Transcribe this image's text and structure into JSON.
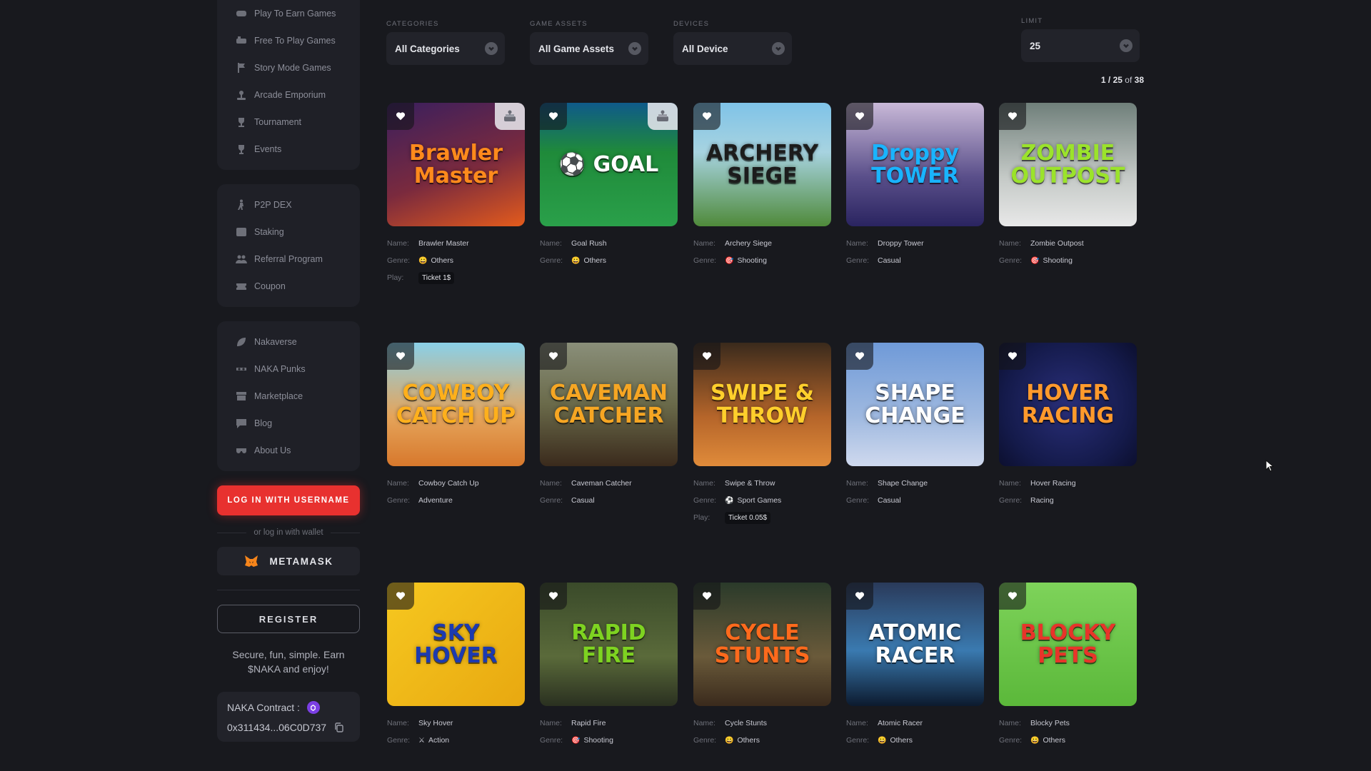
{
  "sidebar": {
    "group1": [
      {
        "label": "Play To Earn Games",
        "icon": "gamepad-icon"
      },
      {
        "label": "Free To Play Games",
        "icon": "controller-icon"
      },
      {
        "label": "Story Mode Games",
        "icon": "flag-icon"
      },
      {
        "label": "Arcade Emporium",
        "icon": "joystick-icon"
      },
      {
        "label": "Tournament",
        "icon": "trophy-icon"
      },
      {
        "label": "Events",
        "icon": "cup-icon"
      }
    ],
    "group2": [
      {
        "label": "P2P DEX",
        "icon": "walk-icon"
      },
      {
        "label": "Staking",
        "icon": "staking-icon"
      },
      {
        "label": "Referral Program",
        "icon": "users-icon"
      },
      {
        "label": "Coupon",
        "icon": "coupon-icon"
      }
    ],
    "group3": [
      {
        "label": "Nakaverse",
        "icon": "leaf-icon"
      },
      {
        "label": "NAKA Punks",
        "icon": "punk-icon"
      },
      {
        "label": "Marketplace",
        "icon": "store-icon"
      },
      {
        "label": "Blog",
        "icon": "chat-icon"
      },
      {
        "label": "About Us",
        "icon": "mask-icon"
      }
    ],
    "login_label": "LOG IN WITH USERNAME",
    "or_text": "or log in with wallet",
    "metamask_label": "METAMASK",
    "register_label": "REGISTER",
    "tagline": "Secure, fun, simple. Earn $NAKA and enjoy!",
    "contract_label": "NAKA Contract :",
    "contract_address": "0x311434...06C0D737"
  },
  "filters": {
    "categories": {
      "label": "CATEGORIES",
      "value": "All Categories"
    },
    "assets": {
      "label": "GAME ASSETS",
      "value": "All Game Assets"
    },
    "devices": {
      "label": "DEVICES",
      "value": "All Device"
    },
    "limit": {
      "label": "LIMIT",
      "value": "25"
    }
  },
  "pagination": {
    "range": "1 / 25",
    "of": "of",
    "total": "38"
  },
  "labels": {
    "name": "Name:",
    "genre": "Genre:",
    "play": "Play:"
  },
  "games": [
    {
      "name": "Brawler Master",
      "genre": "Others",
      "genre_icon": "😀",
      "play": "Ticket 1$",
      "badge": true,
      "title": "Brawler Master",
      "bg": "linear-gradient(160deg,#3a1f5e 0%,#7a2a3e 55%,#e35b1c 100%)",
      "fg": "#ff8a1c"
    },
    {
      "name": "Goal Rush",
      "genre": "Others",
      "genre_icon": "😀",
      "badge": true,
      "title": "⚽ GOAL",
      "bg": "linear-gradient(180deg,#0f5a8a 0%,#1f8a3a 40%,#2aa04a 100%)",
      "fg": "#ffffff"
    },
    {
      "name": "Archery Siege",
      "genre": "Shooting",
      "genre_icon": "🎯",
      "title": "ARCHERY SIEGE",
      "bg": "linear-gradient(180deg,#7fc3e8 0%,#a7d3e0 40%,#4f8a3a 100%)",
      "fg": "#1c1c1c"
    },
    {
      "name": "Droppy Tower",
      "genre": "Casual",
      "genre_icon": "",
      "title": "Droppy TOWER",
      "bg": "linear-gradient(180deg,#c9b9d8 0%,#5a4f8a 60%,#2a2460 100%)",
      "fg": "#19b4ff"
    },
    {
      "name": "Zombie Outpost",
      "genre": "Shooting",
      "genre_icon": "🎯",
      "title": "ZOMBIE OUTPOST",
      "bg": "linear-gradient(180deg,#6f7f7a 0%,#c4c9c6 60%,#e8e8e8 100%)",
      "fg": "#9be32b"
    },
    {
      "name": "Cowboy Catch Up",
      "genre": "Adventure",
      "genre_icon": "",
      "title": "COWBOY CATCH UP",
      "bg": "linear-gradient(180deg,#8ad0e8 0%,#e5a45a 60%,#d7782c 100%)",
      "fg": "#ffb01c"
    },
    {
      "name": "Caveman Catcher",
      "genre": "Casual",
      "genre_icon": "",
      "title": "CAVEMAN CATCHER",
      "bg": "linear-gradient(180deg,#8a8f7a 0%,#6a6a4a 50%,#3a2a1c 100%)",
      "fg": "#f6a623"
    },
    {
      "name": "Swipe & Throw",
      "genre": "Sport Games",
      "genre_icon": "⚽",
      "play": "Ticket 0.05$",
      "title": "SWIPE & THROW",
      "bg": "linear-gradient(180deg,#3a2a1c 0%,#b5652a 60%,#e08b3a 100%)",
      "fg": "#ffcf2c"
    },
    {
      "name": "Shape Change",
      "genre": "Casual",
      "genre_icon": "",
      "title": "SHAPE CHANGE",
      "bg": "linear-gradient(180deg,#6f9ad8 0%,#9fb9e0 60%,#cfd9ee 100%)",
      "fg": "#ffffff"
    },
    {
      "name": "Hover Racing",
      "genre": "Racing",
      "genre_icon": "",
      "title": "HOVER RACING",
      "bg": "radial-gradient(circle at 50% 50%,#2a2f7a 0%,#141a4a 70%,#0c0f2e 100%)",
      "fg": "#ff9a2c"
    },
    {
      "name": "Sky Hover",
      "genre": "Action",
      "genre_icon": "⚔",
      "title": "SKY HOVER",
      "bg": "linear-gradient(135deg,#f6c820 0%,#e8a810 100%)",
      "fg": "#1c3ab0"
    },
    {
      "name": "Rapid Fire",
      "genre": "Shooting",
      "genre_icon": "🎯",
      "title": "RAPID FIRE",
      "bg": "linear-gradient(180deg,#3a4a2a 0%,#5a6a3a 60%,#2a3020 100%)",
      "fg": "#7ed321"
    },
    {
      "name": "Cycle Stunts",
      "genre": "Others",
      "genre_icon": "😀",
      "title": "CYCLE STUNTS",
      "bg": "linear-gradient(180deg,#2a3a2a 0%,#6a5a3a 60%,#3a2a1c 100%)",
      "fg": "#ff6a1c"
    },
    {
      "name": "Atomic Racer",
      "genre": "Others",
      "genre_icon": "😀",
      "title": "ATOMIC RACER",
      "bg": "linear-gradient(180deg,#2a3a5a 0%,#3a7ab0 55%,#0c1a2e 100%)",
      "fg": "#ffffff"
    },
    {
      "name": "Blocky Pets",
      "genre": "Others",
      "genre_icon": "😀",
      "title": "BLOCKY PETS",
      "bg": "linear-gradient(180deg,#7ed35a 0%,#5bb83a 100%)",
      "fg": "#e8342a"
    }
  ],
  "colors": {
    "accent": "#e8312f",
    "background": "#18191e",
    "panel": "#1f2027"
  }
}
